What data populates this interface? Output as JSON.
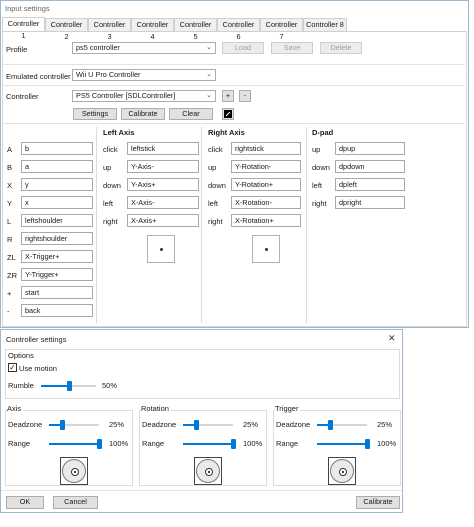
{
  "input_settings": {
    "title": "Input settings",
    "tabs": [
      "Controller 1",
      "Controller 2",
      "Controller 3",
      "Controller 4",
      "Controller 5",
      "Controller 6",
      "Controller 7",
      "Controller 8"
    ],
    "profile_label": "Profile",
    "profile_value": "ps5 controller",
    "load_label": "Load",
    "save_label": "Save",
    "delete_label": "Delete",
    "emulated_label": "Emulated controller",
    "emulated_value": "Wii U Pro Controller",
    "controller_label": "Controller",
    "controller_value": "PS5 Controller [SDLController]",
    "plus_label": "+",
    "minus_label": "-",
    "settings_label": "Settings",
    "calibrate_label": "Calibrate",
    "clear_label": "Clear",
    "buttons": [
      {
        "key": "A",
        "value": "b"
      },
      {
        "key": "B",
        "value": "a"
      },
      {
        "key": "X",
        "value": "y"
      },
      {
        "key": "Y",
        "value": "x"
      },
      {
        "key": "L",
        "value": "leftshoulder"
      },
      {
        "key": "R",
        "value": "rightshoulder"
      },
      {
        "key": "ZL",
        "value": "X-Trigger+"
      },
      {
        "key": "ZR",
        "value": "Y-Trigger+"
      },
      {
        "key": "+",
        "value": "start"
      },
      {
        "key": "-",
        "value": "back"
      }
    ],
    "left_axis": {
      "title": "Left Axis",
      "rows": [
        {
          "key": "click",
          "value": "leftstick"
        },
        {
          "key": "up",
          "value": "Y-Axis-"
        },
        {
          "key": "down",
          "value": "Y-Axis+"
        },
        {
          "key": "left",
          "value": "X-Axis-"
        },
        {
          "key": "right",
          "value": "X-Axis+"
        }
      ]
    },
    "right_axis": {
      "title": "Right Axis",
      "rows": [
        {
          "key": "click",
          "value": "rightstick"
        },
        {
          "key": "up",
          "value": "Y-Rotation-"
        },
        {
          "key": "down",
          "value": "Y-Rotation+"
        },
        {
          "key": "left",
          "value": "X-Rotation-"
        },
        {
          "key": "right",
          "value": "X-Rotation+"
        }
      ]
    },
    "dpad": {
      "title": "D-pad",
      "rows": [
        {
          "key": "up",
          "value": "dpup"
        },
        {
          "key": "down",
          "value": "dpdown"
        },
        {
          "key": "left",
          "value": "dpleft"
        },
        {
          "key": "right",
          "value": "dpright"
        }
      ]
    }
  },
  "controller_settings": {
    "title": "Controller settings",
    "options_label": "Options",
    "use_motion_label": "Use motion",
    "use_motion_checked": true,
    "rumble_label": "Rumble",
    "rumble_value": "50%",
    "rumble_level": 0.5,
    "axis": {
      "title": "Axis",
      "deadzone_label": "Deadzone",
      "deadzone_value": "25%",
      "deadzone_level": 0.25,
      "range_label": "Range",
      "range_value": "100%",
      "range_level": 1.0
    },
    "rotation": {
      "title": "Rotation",
      "deadzone_label": "Deadzone",
      "deadzone_value": "25%",
      "deadzone_level": 0.25,
      "range_label": "Range",
      "range_value": "100%",
      "range_level": 1.0
    },
    "trigger": {
      "title": "Trigger",
      "deadzone_label": "Deadzone",
      "deadzone_value": "25%",
      "deadzone_level": 0.25,
      "range_label": "Range",
      "range_value": "100%",
      "range_level": 1.0
    },
    "ok_label": "OK",
    "cancel_label": "Cancel",
    "calibrate_label": "Calibrate"
  },
  "colors": {
    "accent": "#0078d7",
    "window_border": "#9fb6cc"
  }
}
